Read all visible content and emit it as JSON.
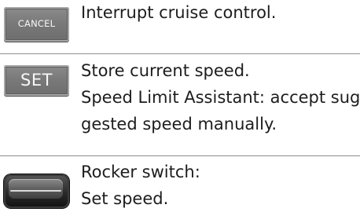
{
  "rows": [
    {
      "key_label": "CANCEL",
      "lines": [
        "Interrupt cruise control."
      ]
    },
    {
      "key_label": "SET",
      "lines": [
        "Store current speed.",
        "Speed Limit Assistant: accept sug-",
        "gested speed manually."
      ]
    },
    {
      "key_label": "",
      "icon": "rocker-switch-icon",
      "lines": [
        "Rocker switch:",
        "Set speed."
      ]
    }
  ],
  "colors": {
    "text": "#1d1d1d",
    "divider": "#8e8e8e",
    "keycap": "#7a7a7a",
    "keycap_text": "#f7f7f7",
    "rocker_body": "#2a2a2a"
  }
}
